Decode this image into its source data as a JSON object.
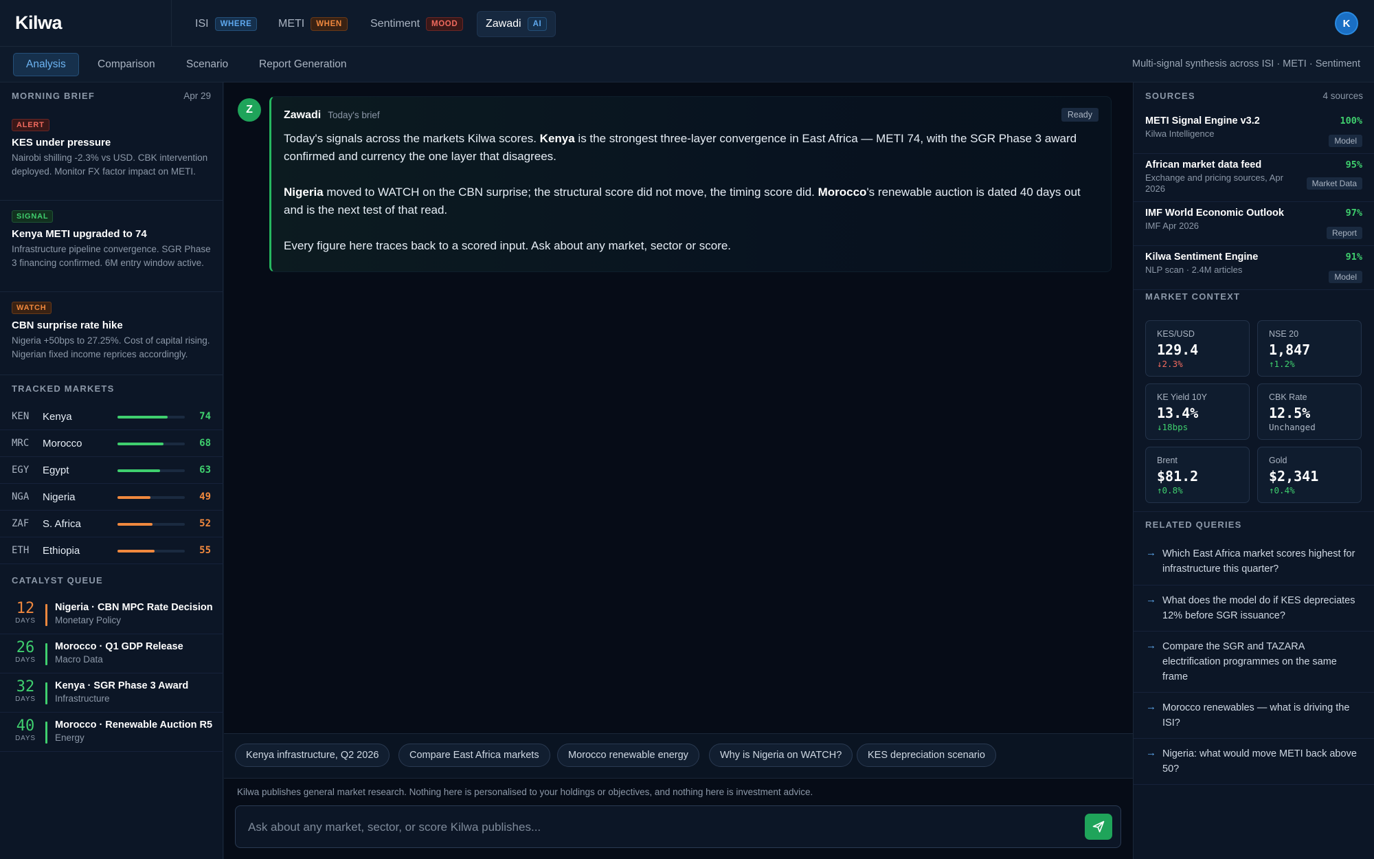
{
  "app": {
    "logo": "Kilwa",
    "avatar_initial": "K"
  },
  "engines": [
    {
      "name": "ISI",
      "badge": "WHERE"
    },
    {
      "name": "METI",
      "badge": "WHEN"
    },
    {
      "name": "Sentiment",
      "badge": "MOOD"
    },
    {
      "name": "Zawadi",
      "badge": "AI"
    }
  ],
  "subnav": {
    "tabs": [
      "Analysis",
      "Comparison",
      "Scenario",
      "Report Generation"
    ],
    "note": "Multi-signal synthesis across ISI · METI · Sentiment"
  },
  "brief": {
    "title": "MORNING BRIEF",
    "date": "Apr 29",
    "items": [
      {
        "tag": "ALERT",
        "title": "KES under pressure",
        "body": "Nairobi shilling -2.3% vs USD. CBK intervention deployed. Monitor FX factor impact on METI."
      },
      {
        "tag": "SIGNAL",
        "title": "Kenya METI upgraded to 74",
        "body": "Infrastructure pipeline convergence. SGR Phase 3 financing confirmed. 6M entry window active."
      },
      {
        "tag": "WATCH",
        "title": "CBN surprise rate hike",
        "body": "Nigeria +50bps to 27.25%. Cost of capital rising. Nigerian fixed income reprices accordingly."
      }
    ]
  },
  "tracked": {
    "title": "TRACKED MARKETS",
    "markets": [
      {
        "code": "KEN",
        "name": "Kenya",
        "score": "74",
        "level": 0.74
      },
      {
        "code": "MRC",
        "name": "Morocco",
        "score": "68",
        "level": 0.68
      },
      {
        "code": "EGY",
        "name": "Egypt",
        "score": "63",
        "level": 0.63
      },
      {
        "code": "NGA",
        "name": "Nigeria",
        "score": "49",
        "level": 0.49
      },
      {
        "code": "ZAF",
        "name": "S. Africa",
        "score": "52",
        "level": 0.52
      },
      {
        "code": "ETH",
        "name": "Ethiopia",
        "score": "55",
        "level": 0.55
      }
    ]
  },
  "catalysts": {
    "title": "CATALYST QUEUE",
    "days_label": "DAYS",
    "items": [
      {
        "days": "12",
        "title": "Nigeria · CBN MPC Rate Decision",
        "sub": "Monetary Policy"
      },
      {
        "days": "26",
        "title": "Morocco · Q1 GDP Release",
        "sub": "Macro Data"
      },
      {
        "days": "32",
        "title": "Kenya · SGR Phase 3 Award",
        "sub": "Infrastructure"
      },
      {
        "days": "40",
        "title": "Morocco · Renewable Auction R5",
        "sub": "Energy"
      }
    ]
  },
  "message": {
    "avatar": "Z",
    "author": "Zawadi",
    "when": "Today's brief",
    "status": "Ready",
    "p1_a": "Today's signals across the markets Kilwa scores. ",
    "p1_b": "Kenya",
    "p1_c": " is the strongest three-layer convergence in East Africa — METI 74, with the SGR Phase 3 award confirmed and currency the one layer that disagrees.",
    "p2_a": "Nigeria",
    "p2_b": " moved to WATCH on the CBN surprise; the structural score did not move, the timing score did. ",
    "p2_c": "Morocco",
    "p2_d": "'s renewable auction is dated 40 days out and is the next test of that read.",
    "p3": "Every figure here traces back to a scored input. Ask about any market, sector or score."
  },
  "chips": [
    "Kenya infrastructure, Q2 2026",
    "Compare East Africa markets",
    "Morocco renewable energy",
    "Why is Nigeria on WATCH?",
    "KES depreciation scenario"
  ],
  "disclaimer": "Kilwa publishes general market research. Nothing here is personalised to your holdings or objectives, and nothing here is investment advice.",
  "input": {
    "placeholder": "Ask about any market, sector, or score Kilwa publishes..."
  },
  "sources": {
    "title": "SOURCES",
    "count": "4 sources",
    "items": [
      {
        "name": "METI Signal Engine v3.2",
        "sub": "Kilwa Intelligence",
        "pct": "100%",
        "badge": "Model"
      },
      {
        "name": "African market data feed",
        "sub": "Exchange and pricing sources, Apr 2026",
        "pct": "95%",
        "badge": "Market Data"
      },
      {
        "name": "IMF World Economic Outlook",
        "sub": "IMF Apr 2026",
        "pct": "97%",
        "badge": "Report"
      },
      {
        "name": "Kilwa Sentiment Engine",
        "sub": "NLP scan · 2.4M articles",
        "pct": "91%",
        "badge": "Model"
      }
    ]
  },
  "context": {
    "title": "MARKET CONTEXT",
    "cards": [
      {
        "label": "KES/USD",
        "value": "129.4",
        "delta": "↓2.3%",
        "tone": "down"
      },
      {
        "label": "NSE 20",
        "value": "1,847",
        "delta": "↑1.2%",
        "tone": "up"
      },
      {
        "label": "KE Yield 10Y",
        "value": "13.4%",
        "delta": "↓18bps",
        "tone": "up"
      },
      {
        "label": "CBK Rate",
        "value": "12.5%",
        "delta": "Unchanged",
        "tone": "flat"
      },
      {
        "label": "Brent",
        "value": "$81.2",
        "delta": "↑0.8%",
        "tone": "up"
      },
      {
        "label": "Gold",
        "value": "$2,341",
        "delta": "↑0.4%",
        "tone": "up"
      }
    ]
  },
  "related": {
    "title": "RELATED QUERIES",
    "items": [
      "Which East Africa market scores highest for infrastructure this quarter?",
      "What does the model do if KES depreciates 12% before SGR issuance?",
      "Compare the SGR and TAZARA electrification programmes on the same frame",
      "Morocco renewables — what is driving the ISI?",
      "Nigeria: what would move METI back above 50?"
    ]
  },
  "colors": {
    "accent_green": "#26b75f",
    "accent_blue": "#5ea8ee",
    "score_high": "#3fcf6e",
    "score_mid": "#f0883e",
    "down": "#f06a5e"
  }
}
